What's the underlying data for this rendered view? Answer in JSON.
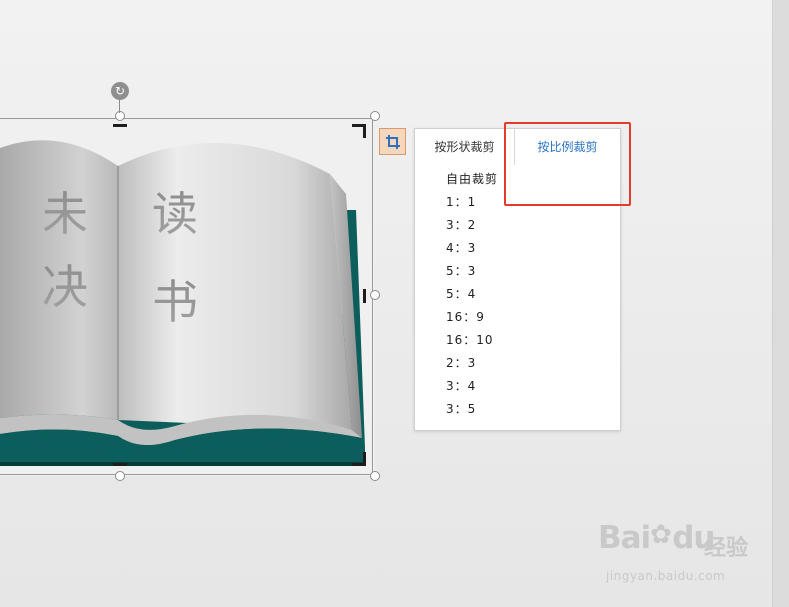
{
  "image": {
    "left_page_text": [
      "未",
      "决"
    ],
    "right_page_text": [
      "读",
      "书"
    ],
    "colors": {
      "cover": "#0a5a57",
      "cover_dark": "#073f3d",
      "page": "#d8d8d8"
    }
  },
  "crop_panel": {
    "tabs": [
      {
        "label": "按形状裁剪",
        "active": false
      },
      {
        "label": "按比例裁剪",
        "active": true
      }
    ],
    "ratios": [
      "自由裁剪",
      "1：1",
      "3：2",
      "4：3",
      "5：3",
      "5：4",
      "16：9",
      "16：10",
      "2：3",
      "3：4",
      "3：5"
    ]
  },
  "watermark": {
    "logo": "Bai",
    "logo_suffix": "du",
    "brand": "经验",
    "url": "jingyan.baidu.com"
  },
  "colors": {
    "highlight": "#e53b2c",
    "active_tab": "#2b74c7",
    "crop_button_bg": "#f6d7be"
  }
}
